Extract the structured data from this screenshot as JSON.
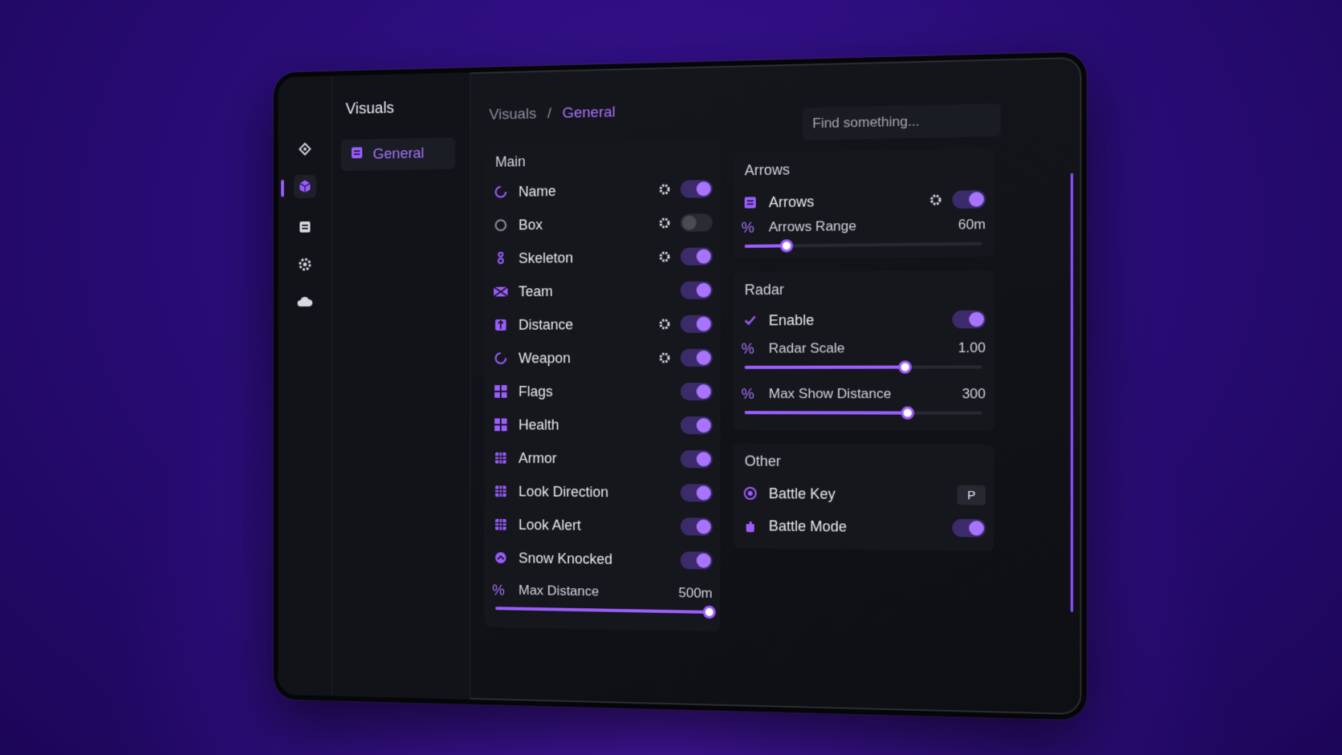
{
  "theme": {
    "accent": "#9c5cff",
    "background": "#15171d"
  },
  "rail": {
    "icons": [
      "diamond-icon",
      "cube-icon",
      "list-icon",
      "gear-icon",
      "cloud-icon"
    ],
    "active": "cube-icon"
  },
  "subnav": {
    "title": "Visuals",
    "items": [
      {
        "label": "General",
        "icon": "list-icon",
        "active": true
      }
    ]
  },
  "breadcrumb": {
    "parent": "Visuals",
    "separator": "/",
    "current": "General"
  },
  "search": {
    "placeholder": "Find something..."
  },
  "main": {
    "title": "Main",
    "items": [
      {
        "label": "Name",
        "icon": "circle-spinner-icon",
        "gear": true,
        "on": true
      },
      {
        "label": "Box",
        "icon": "circle-outline-icon",
        "gear": true,
        "on": false
      },
      {
        "label": "Skeleton",
        "icon": "skeleton-icon",
        "gear": true,
        "on": true
      },
      {
        "label": "Team",
        "icon": "team-flag-icon",
        "gear": false,
        "on": true
      },
      {
        "label": "Distance",
        "icon": "distance-icon",
        "gear": true,
        "on": true
      },
      {
        "label": "Weapon",
        "icon": "circle-spinner-icon",
        "gear": true,
        "on": true
      },
      {
        "label": "Flags",
        "icon": "flags-icon",
        "gear": false,
        "on": true
      },
      {
        "label": "Health",
        "icon": "health-icon",
        "gear": false,
        "on": true
      },
      {
        "label": "Armor",
        "icon": "grid-icon",
        "gear": false,
        "on": true
      },
      {
        "label": "Look Direction",
        "icon": "grid-icon",
        "gear": false,
        "on": true
      },
      {
        "label": "Look Alert",
        "icon": "grid-icon",
        "gear": false,
        "on": true
      },
      {
        "label": "Snow Knocked",
        "icon": "knocked-icon",
        "gear": false,
        "on": true
      }
    ],
    "max_distance": {
      "label": "Max Distance",
      "value": "500m",
      "fraction": 1.0
    }
  },
  "arrows": {
    "title": "Arrows",
    "toggle": {
      "label": "Arrows",
      "icon": "list-icon",
      "gear": true,
      "on": true
    },
    "range": {
      "label": "Arrows Range",
      "value": "60m",
      "fraction": 0.18
    }
  },
  "radar": {
    "title": "Radar",
    "enable": {
      "label": "Enable",
      "icon": "check-icon",
      "on": true
    },
    "scale": {
      "label": "Radar Scale",
      "value": "1.00",
      "fraction": 0.68
    },
    "max_show": {
      "label": "Max Show Distance",
      "value": "300",
      "fraction": 0.69
    }
  },
  "other": {
    "title": "Other",
    "battle_key": {
      "label": "Battle Key",
      "icon": "target-icon",
      "key": "P"
    },
    "battle_mode": {
      "label": "Battle Mode",
      "icon": "hand-icon",
      "on": true
    }
  }
}
